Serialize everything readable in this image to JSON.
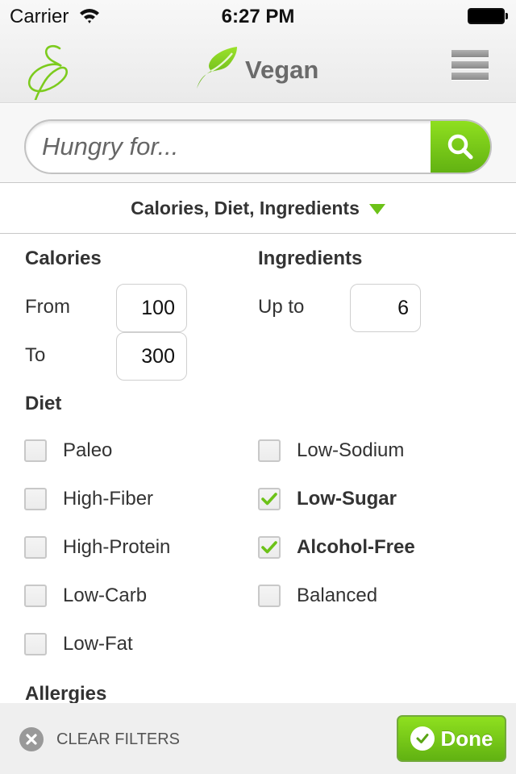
{
  "status_bar": {
    "carrier": "Carrier",
    "time": "6:27 PM",
    "battery_level": 1.0
  },
  "nav": {
    "logo_icon": "script-e-logo",
    "title_icon": "leaf-icon",
    "title": "Vegan",
    "menu_icon": "hamburger-menu-icon"
  },
  "search": {
    "placeholder": "Hungry for...",
    "value": "",
    "button_icon": "search-icon"
  },
  "filter_toggle": {
    "label": "Calories, Diet, Ingredients",
    "icon": "triangle-down-icon"
  },
  "calories": {
    "heading": "Calories",
    "from_label": "From",
    "from_value": "100",
    "to_label": "To",
    "to_value": "300"
  },
  "ingredients": {
    "heading": "Ingredients",
    "upto_label": "Up to",
    "upto_value": "6"
  },
  "diet": {
    "heading": "Diet",
    "options": [
      {
        "label": "Paleo",
        "checked": false
      },
      {
        "label": "Low-Sodium",
        "checked": false
      },
      {
        "label": "High-Fiber",
        "checked": false
      },
      {
        "label": "Low-Sugar",
        "checked": true
      },
      {
        "label": "High-Protein",
        "checked": false
      },
      {
        "label": "Alcohol-Free",
        "checked": true
      },
      {
        "label": "Low-Carb",
        "checked": false
      },
      {
        "label": "Balanced",
        "checked": false
      },
      {
        "label": "Low-Fat",
        "checked": false
      }
    ]
  },
  "allergies": {
    "heading": "Allergies"
  },
  "bottom_bar": {
    "clear_label": "CLEAR FILTERS",
    "clear_icon": "close-circle-icon",
    "done_label": "Done",
    "done_icon": "check-circle-icon"
  },
  "colors": {
    "accent_green": "#76c81a",
    "text_dark": "#333333",
    "title_gray": "#6b6b6b"
  }
}
